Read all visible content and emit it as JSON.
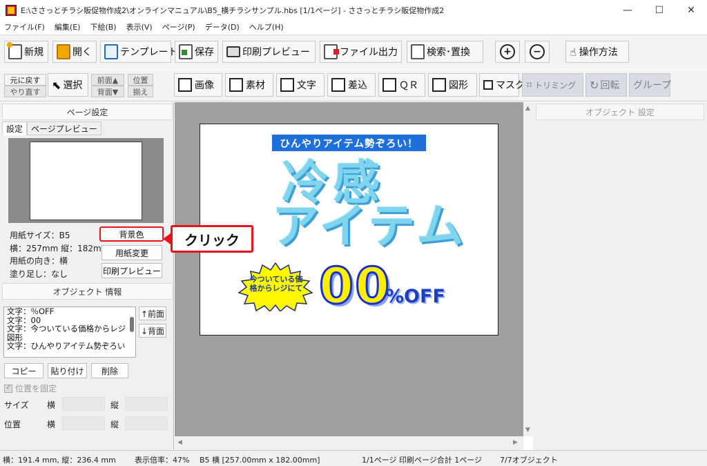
{
  "window": {
    "title": "E:\\ささっとチラシ販促物作成2\\オンラインマニュアル\\B5_横チラシサンプル.hbs  [1/1ページ] - ささっとチラシ販促物作成2",
    "minimize": "—",
    "maximize": "☐",
    "close": "✕"
  },
  "menu": [
    "ファイル(F)",
    "編集(E)",
    "下絵(B)",
    "表示(V)",
    "ページ(P)",
    "データ(D)",
    "ヘルプ(H)"
  ],
  "toolbar1": {
    "new": "新規",
    "open": "開く",
    "template": "テンプレート",
    "save": "保存",
    "print_preview": "印刷プレビュー",
    "file_export": "ファイル出力",
    "search_replace": "検索･置換",
    "zoom_in": "+",
    "zoom_out": "−",
    "how_to": "操作方法"
  },
  "toolbar2": {
    "undo": "元に戻す",
    "redo": "やり直す",
    "select": "選択",
    "front": "前面▲",
    "back": "背面▼",
    "align1": "位置",
    "align2": "揃え",
    "image": "画像",
    "material": "素材",
    "text": "文字",
    "merge": "差込",
    "qr": "ＱＲ",
    "shape": "図形",
    "mask": "マスク",
    "trimming": "トリミング",
    "rotate": "回転",
    "group": "グループ"
  },
  "left_panel": {
    "page_settings_header": "ページ設定",
    "tabs": [
      "設定",
      "ページプレビュー"
    ],
    "paper_size": "用紙サイズ：B5",
    "dimensions": "横：257mm 縦：182mm",
    "orientation": "用紙の向き：横",
    "bleed": "塗り足し：なし",
    "bg_color_button": "背景色",
    "change_paper_button": "用紙変更",
    "print_preview_button": "印刷プレビュー",
    "object_info_header": "オブジェクト 情報",
    "objects": [
      "文字：％OFF",
      "文字：00",
      "文字：今ついている価格からレジ",
      "図形",
      "文字：ひんやりアイテム勢ぞろい"
    ],
    "bring_front": "↑前面",
    "send_back": "↓背面",
    "copy": "コピー",
    "paste": "貼り付け",
    "delete": "削除",
    "lock_position": "位置を固定",
    "size_label": "サイズ",
    "position_label": "位置",
    "width_label": "横",
    "height_label": "縦"
  },
  "callout": "クリック",
  "flyer": {
    "banner": "ひんやりアイテム勢ぞろい！",
    "title_line1": "冷感",
    "title_line2": "アイテム",
    "burst_text": "今ついている価格からレジにて",
    "discount_number": "00",
    "discount_suffix": "%OFF"
  },
  "right_panel": {
    "header": "オブジェクト 設定"
  },
  "status": {
    "cursor": "横：191.4 mm, 縦：236.4 mm",
    "zoom": "表示倍率：47%",
    "paper": "B5 横 [257.00mm x 182.00mm]",
    "page": "1/1ページ 印刷ページ合計 1ページ",
    "objects": "7/7オブジェクト"
  }
}
